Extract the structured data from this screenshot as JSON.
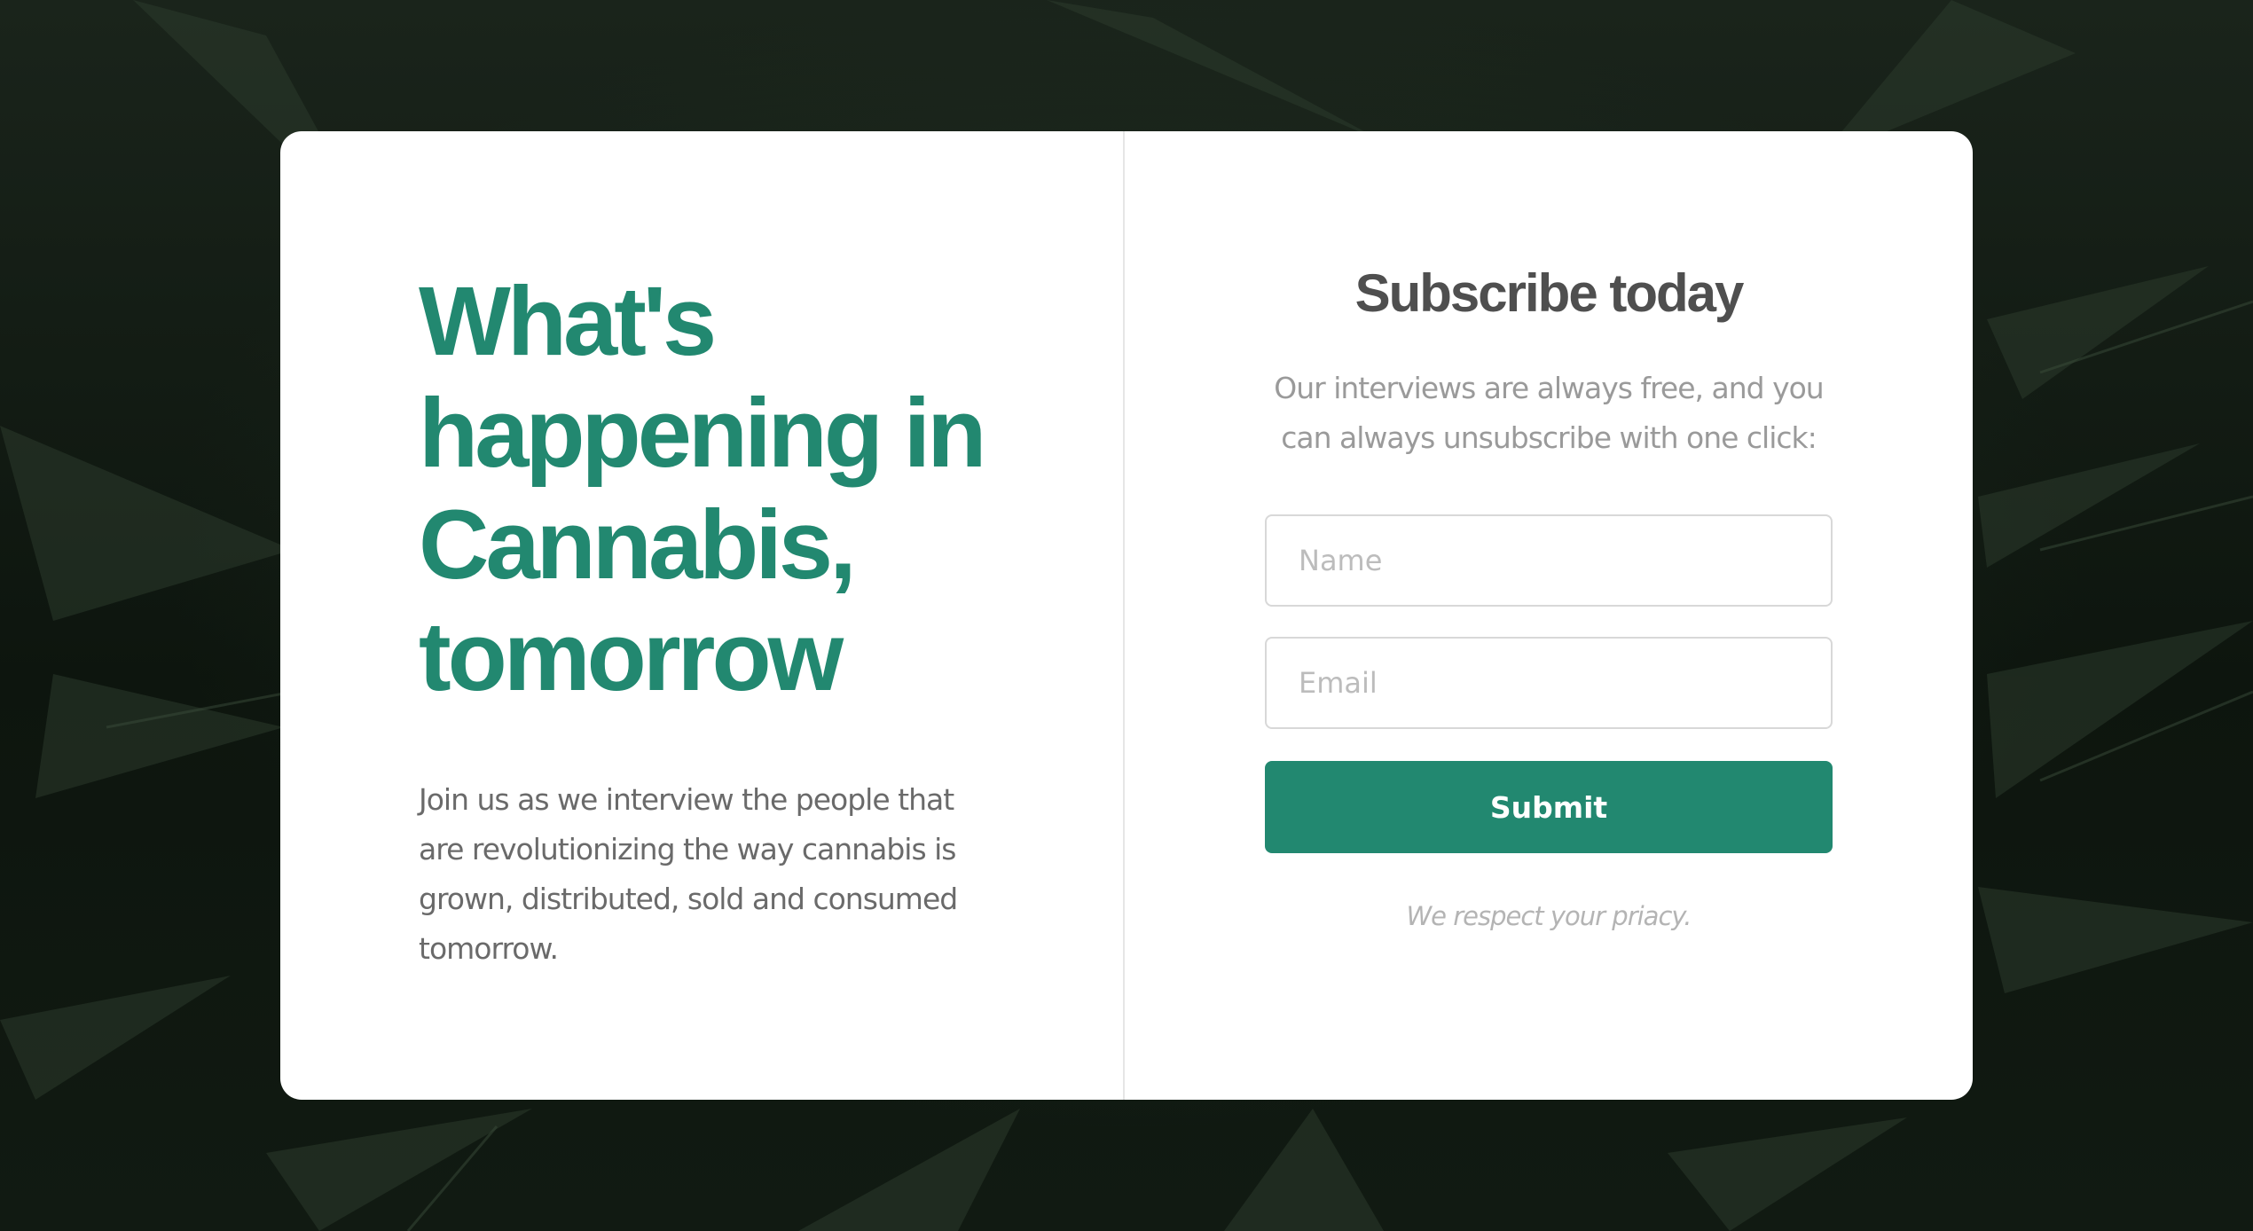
{
  "hero": {
    "headline": "What's happening in Cannabis, tomorrow",
    "description": "Join us as we interview the people that are revolutionizing the way cannabis is grown, distributed, sold and consumed tomorrow."
  },
  "subscribe": {
    "title": "Subscribe today",
    "description": "Our interviews are always free, and you can always unsubscribe with one click:",
    "name_placeholder": "Name",
    "email_placeholder": "Email",
    "submit_label": "Submit",
    "privacy_note": "We respect your priacy."
  },
  "colors": {
    "accent": "#228870",
    "heading_gray": "#4f4f4f",
    "body_gray": "#6a6a6a",
    "muted_gray": "#9a9a9a",
    "background": "#0c130d"
  },
  "icons": {
    "background": "cannabis-leaves-photo"
  }
}
